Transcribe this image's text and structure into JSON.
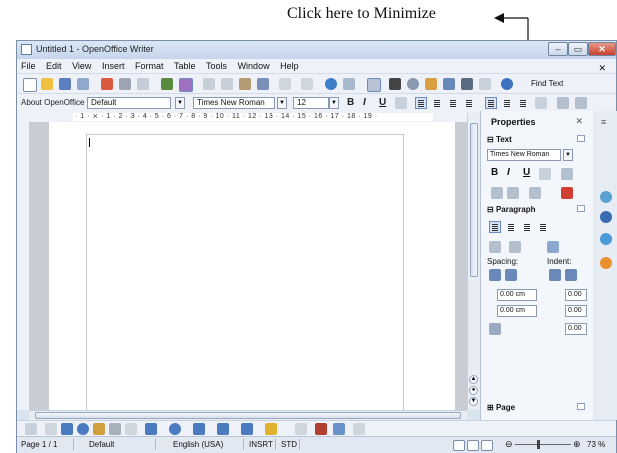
{
  "annotation": {
    "text": "Click here to Minimize"
  },
  "window": {
    "title": "Untitled 1 - OpenOffice Writer",
    "controls": {
      "minimize": "–",
      "maximize": "▭",
      "close": "✕"
    }
  },
  "menu": [
    "File",
    "Edit",
    "View",
    "Insert",
    "Format",
    "Table",
    "Tools",
    "Window",
    "Help"
  ],
  "toolbar": {
    "find_text": "Find Text"
  },
  "formatting": {
    "style_box": "About OpenOffice",
    "paragraph_style": "Default",
    "font_name": "Times New Roman",
    "font_size": "12",
    "bold": "B",
    "italic": "I",
    "underline": "U"
  },
  "ruler": {
    "ticks": "· 1 · ⨯ · 1 · 2 · 3 · 4 · 5 · 6 · 7 · 8 · 9 · 10 · 11 · 12 · 13 · 14 · 15 · 16 · 17 · 18 · 19 ·"
  },
  "sidebar": {
    "title": "Properties",
    "text_section": "Text",
    "font_name": "Times New Roman",
    "bold": "B",
    "italic": "I",
    "underline": "U",
    "paragraph_section": "Paragraph",
    "spacing_label": "Spacing:",
    "indent_label": "Indent:",
    "spacing_above": "0.00 cm",
    "spacing_below": "0.00 cm",
    "indent_before": "0.00",
    "indent_after": "0.00",
    "indent_first": "0.00",
    "page_section": "Page"
  },
  "status": {
    "page": "Page 1 / 1",
    "style": "Default",
    "language": "English (USA)",
    "insert_mode": "INSRT",
    "selection_mode": "STD",
    "zoom": "73 %"
  }
}
